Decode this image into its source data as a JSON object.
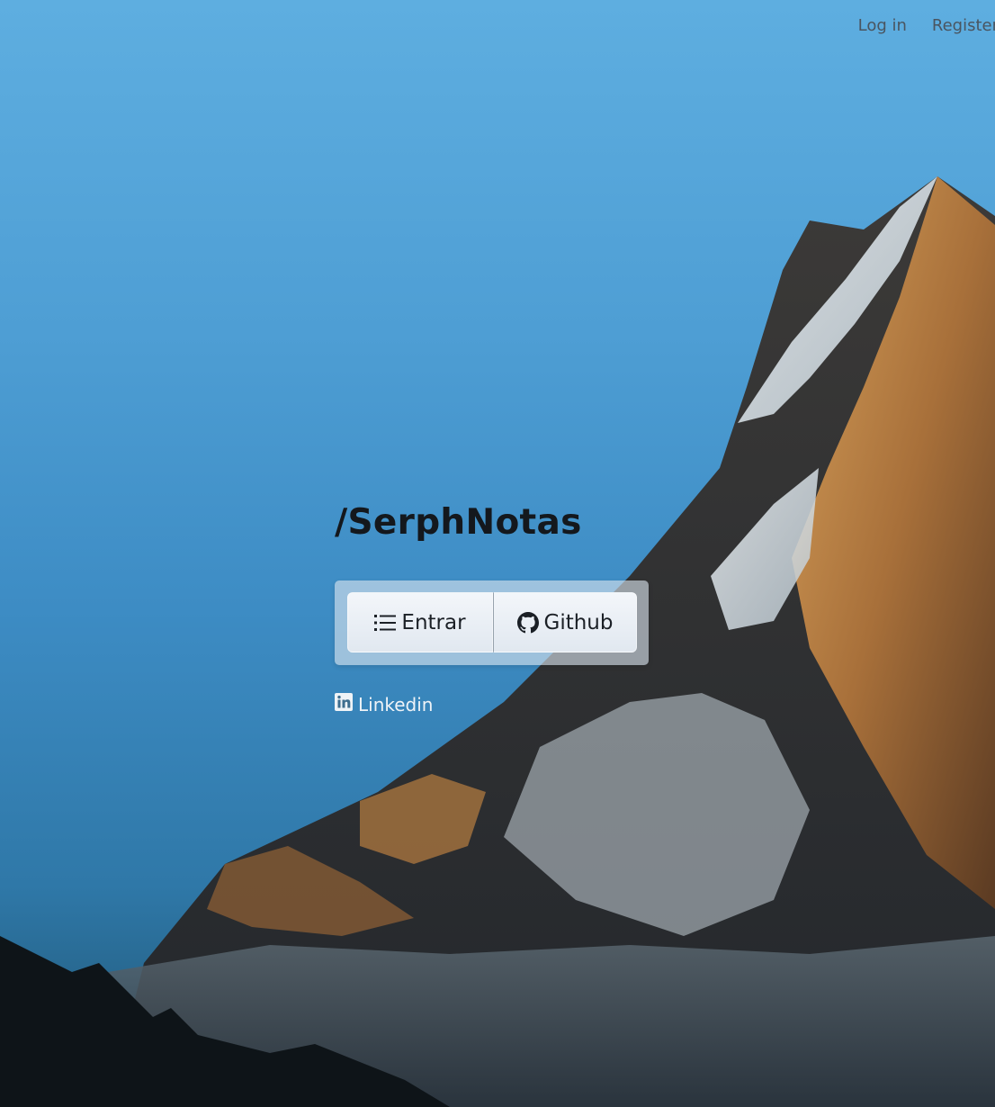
{
  "nav": {
    "login_label": "Log in",
    "register_label": "Register"
  },
  "hero": {
    "title": "/SerphNotas",
    "entrar_label": "Entrar",
    "github_label": "Github",
    "linkedin_label": "Linkedin"
  },
  "icons": {
    "entrar": "list-icon",
    "github": "github-icon",
    "linkedin": "linkedin-icon"
  },
  "colors": {
    "sky": "#4e9ed4",
    "title": "#14181d",
    "nav_text": "#4a5560",
    "button_bg": "#e8eef4",
    "linkedin_text": "#eef3f7"
  }
}
